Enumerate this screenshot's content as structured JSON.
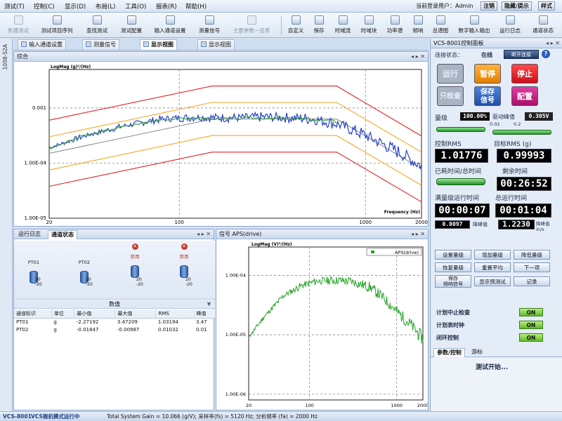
{
  "menu": [
    "测试(T)",
    "控制(C)",
    "显示(D)",
    "布局(L)",
    "工具(O)",
    "报表(R)",
    "帮助(H)"
  ],
  "user_label": "当前登录用户：Admin",
  "menu_buttons": {
    "logout": "注销",
    "hide_prompt": "隐藏/提示",
    "style": "样式"
  },
  "toolbar_left": [
    {
      "label": "新建测试",
      "icon": "new-test-icon",
      "enabled": false
    },
    {
      "label": "测试项目序列",
      "icon": "sequence-icon",
      "enabled": true
    },
    {
      "label": "查找测试",
      "icon": "find-test-icon",
      "enabled": true
    },
    {
      "label": "测试配置",
      "icon": "config-icon",
      "enabled": true
    },
    {
      "label": "输入通道设置",
      "icon": "input-channel-icon",
      "enabled": true
    },
    {
      "label": "测量信号",
      "icon": "measure-signal-icon",
      "enabled": true
    },
    {
      "label": "主要参数一览表",
      "icon": "param-table-icon",
      "enabled": false
    }
  ],
  "toolbar_right": [
    {
      "label": "自定义",
      "icon": "custom-icon"
    },
    {
      "label": "保存",
      "icon": "save-icon"
    },
    {
      "label": "时域流",
      "icon": "time-stream-icon"
    },
    {
      "label": "时域块",
      "icon": "time-block-icon"
    },
    {
      "label": "功率谱",
      "icon": "power-spectrum-icon"
    },
    {
      "label": "频响",
      "icon": "freq-response-icon"
    },
    {
      "label": "总谱图",
      "icon": "spectrogram-icon"
    },
    {
      "label": "数字输入输出",
      "icon": "digital-io-icon"
    },
    {
      "label": "运行日志",
      "icon": "run-log-icon"
    },
    {
      "label": "通道状态",
      "icon": "channel-status-icon"
    }
  ],
  "side_strip_label": "1008-S2A",
  "doc_tabs": [
    "输入通道设置",
    "测量信号",
    "显示视图",
    "显示视图"
  ],
  "main_chart": {
    "panel_title": "综合",
    "ylabel": "LogMag (g)²/(Hz)",
    "xlabel": "Frequency (Hz)",
    "y_ticks": [
      "0.001",
      "1.00E-04",
      "1.00E-05"
    ],
    "x_ticks": [
      "20",
      "100",
      "1000",
      "2000"
    ]
  },
  "chart_data": {
    "type": "line",
    "title": "",
    "xlabel": "Frequency (Hz)",
    "ylabel": "LogMag (g)²/(Hz)",
    "x_scale": "log",
    "y_scale": "log",
    "xlim": [
      20,
      2000
    ],
    "ylim": [
      1e-05,
      0.005
    ],
    "series": [
      {
        "name": "abort-upper",
        "color": "#e32222",
        "x": [
          20,
          150,
          700,
          2000
        ],
        "y": [
          0.0006,
          0.0025,
          0.0025,
          0.00031
        ]
      },
      {
        "name": "alarm-upper",
        "color": "#f5a623",
        "x": [
          20,
          150,
          700,
          2000
        ],
        "y": [
          0.0003,
          0.00126,
          0.00126,
          0.000158
        ]
      },
      {
        "name": "reference",
        "color": "#7a7a7a",
        "x": [
          20,
          150,
          700,
          2000
        ],
        "y": [
          0.00015,
          0.00063,
          0.00063,
          7.9e-05
        ]
      },
      {
        "name": "alarm-lower",
        "color": "#f5a623",
        "x": [
          20,
          150,
          700,
          2000
        ],
        "y": [
          7.5e-05,
          0.000316,
          0.000316,
          3.95e-05
        ]
      },
      {
        "name": "abort-lower",
        "color": "#e32222",
        "x": [
          20,
          150,
          700,
          2000
        ],
        "y": [
          3.8e-05,
          0.000158,
          0.000158,
          1.98e-05
        ]
      },
      {
        "name": "control",
        "color": "#1a35c8",
        "x": [
          20,
          30,
          50,
          80,
          120,
          200,
          300,
          500,
          700,
          1000,
          1500,
          2000
        ],
        "y": [
          0.00019,
          0.0003,
          0.00047,
          0.00063,
          0.00068,
          0.00066,
          0.00069,
          0.00064,
          0.00052,
          0.00032,
          0.00016,
          9e-05
        ]
      },
      {
        "name": "demand",
        "color": "#2aa12a",
        "x": [
          20,
          30,
          50,
          80,
          120,
          200,
          300,
          500,
          700
        ],
        "y": [
          0.00018,
          0.00031,
          0.00046,
          0.00062,
          0.00066,
          0.00064,
          0.00067,
          0.00063,
          0.00056
        ]
      }
    ]
  },
  "log_tabs": [
    "运行日志",
    "通道状态"
  ],
  "channels": [
    {
      "name": "PT01",
      "upper": "20",
      "lower": "-20",
      "error": false
    },
    {
      "name": "PT02",
      "upper": "20",
      "lower": "-20",
      "error": false
    },
    {
      "name": "禁用",
      "upper": "20",
      "lower": "-20",
      "error": true
    },
    {
      "name": "禁用",
      "upper": "20",
      "lower": "-20",
      "error": true
    }
  ],
  "data_section_label": "数值",
  "data_table": {
    "headers": [
      "通道标识",
      "单位",
      "最小值",
      "最大值",
      "RMS",
      "峰值"
    ],
    "rows": [
      [
        "PT01",
        "g",
        "-2.27192",
        "3.47209",
        "1.03194",
        "3.47"
      ],
      [
        "PT02",
        "g",
        "-0.01847",
        "-0.00987",
        "0.01032",
        "0.01"
      ]
    ]
  },
  "aps_chart": {
    "panel_title": "信号 APS(drive)",
    "ylabel": "LogMag (V)²/(Hz)",
    "legend": "APS(drive)",
    "y_ticks": [
      "1.00E-04",
      "1.00E-05",
      "1.00E-06"
    ],
    "x_ticks": [
      "20",
      "100",
      "1000",
      "2000"
    ],
    "series": {
      "name": "APS(drive)",
      "color": "#27a327",
      "x": [
        20,
        30,
        50,
        80,
        120,
        200,
        300,
        500,
        700,
        1000,
        1500,
        2000
      ],
      "y": [
        9e-06,
        2e-05,
        4.5e-05,
        6.7e-05,
        8e-05,
        8.3e-05,
        7.9e-05,
        6.3e-05,
        4.2e-05,
        2.5e-05,
        1.4e-05,
        8.5e-06
      ]
    }
  },
  "control_panel": {
    "title": "VCS-8001控制面板",
    "connection_label": "连接状态：",
    "connection_status": "在线",
    "connection_button": "断开连接",
    "help": "?",
    "buttons": [
      {
        "label": "运行",
        "color": "#a8b4c4"
      },
      {
        "label": "暂停",
        "color": "#f39200"
      },
      {
        "label": "停止",
        "color": "#e4161f"
      },
      {
        "label": "只检查",
        "color": "#a8b4c4"
      },
      {
        "label": "保存\n信号",
        "color": "#2d67c4"
      },
      {
        "label": "配置",
        "color": "#c0167d"
      }
    ],
    "level_label": "量级",
    "level_value": "100.00%",
    "drive_peak_label": "驱动峰值",
    "drive_peak_value": "0.305V",
    "bar1_scale": "0.02",
    "bar2_scale": "0.2",
    "control_rms_label": "控制RMS",
    "control_rms_value": "1.01776",
    "target_rms_label": "目标RMS (g)",
    "target_rms_value": "0.99993",
    "elapsed_label": "已耗时间/总时间",
    "remaining_label": "剩余时间",
    "remaining_value": "00:26:52",
    "level_runtime_label": "满量级运行时间",
    "total_runtime_label": "总运行时间",
    "level_runtime_value": "00:00:07",
    "total_runtime_value": "00:01:04",
    "peak_small_value": "0.0097",
    "peak_small_unit": "降峰值",
    "peak_value": "1.2230",
    "peak_unit": "降峰值 in/s",
    "action_buttons": [
      "设置量级",
      "增加量级",
      "降低量级",
      "恢复量级",
      "重置平均",
      "下一项",
      "保存\n频响信号",
      "显示预测试",
      "记录"
    ],
    "toggles": [
      {
        "label": "计划中止检查",
        "state": "ON"
      },
      {
        "label": "计划表时钟",
        "state": "ON"
      },
      {
        "label": "闭环控制",
        "state": "ON"
      }
    ],
    "bottom_tabs": [
      "参数/控制",
      "游标"
    ],
    "status_message": "测试开始..."
  },
  "status_bar": {
    "app": "VCS-8001",
    "mode": "VCS振机模式运行中",
    "info": "Total System Gain = 10.066 (g/V); 采样率(fs) = 5120 Hz; 分析频率 (fa) = 2000 Hz"
  }
}
